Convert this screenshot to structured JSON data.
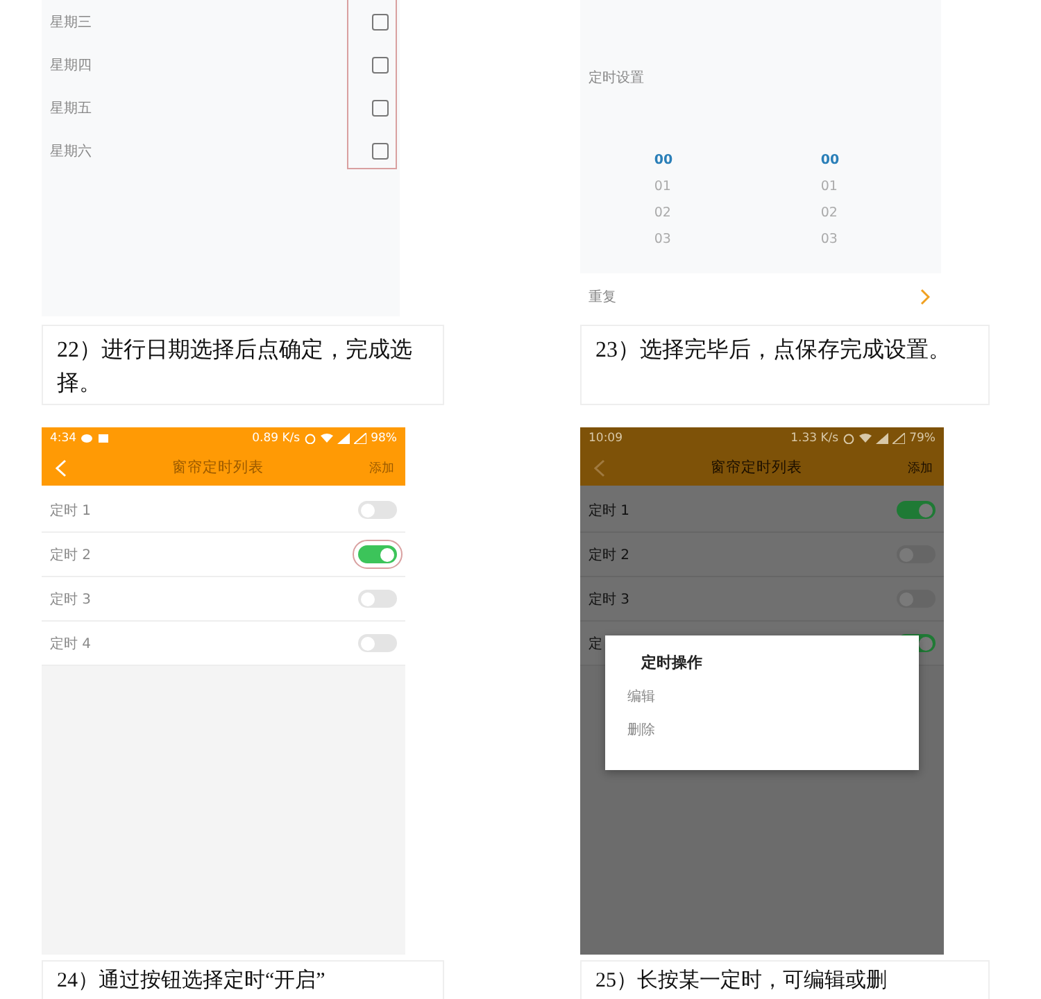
{
  "step22_screen": {
    "days": [
      {
        "label": "星期三",
        "checked": false
      },
      {
        "label": "星期四",
        "checked": false
      },
      {
        "label": "星期五",
        "checked": false
      },
      {
        "label": "星期六",
        "checked": false
      }
    ]
  },
  "step23_screen": {
    "section_title": "定时设置",
    "hour_column": [
      {
        "value": "00",
        "selected": true
      },
      {
        "value": "01",
        "selected": false
      },
      {
        "value": "02",
        "selected": false
      },
      {
        "value": "03",
        "selected": false
      }
    ],
    "minute_column": [
      {
        "value": "00",
        "selected": true
      },
      {
        "value": "01",
        "selected": false
      },
      {
        "value": "02",
        "selected": false
      },
      {
        "value": "03",
        "selected": false
      }
    ],
    "repeat_label": "重复"
  },
  "captions_top": [
    "22）进行日期选择后点确定，完成选择。",
    "23）选择完毕后，点保存完成设置。"
  ],
  "step24_screen": {
    "status_bar": {
      "time": "4:34",
      "speed": "0.89 K/s",
      "battery": "98%"
    },
    "title": "窗帘定时列表",
    "action": "添加",
    "timers": [
      {
        "label": "定时 1",
        "on": false
      },
      {
        "label": "定时 2",
        "on": true
      },
      {
        "label": "定时 3",
        "on": false
      },
      {
        "label": "定时 4",
        "on": false
      }
    ]
  },
  "step25_screen": {
    "status_bar": {
      "time": "10:09",
      "speed": "1.33 K/s",
      "battery": "79%"
    },
    "title": "窗帘定时列表",
    "action": "添加",
    "timers": [
      {
        "label": "定时 1",
        "on": true
      },
      {
        "label": "定时 2",
        "on": false
      },
      {
        "label": "定时 3",
        "on": false
      },
      {
        "label": "定",
        "on": true
      }
    ],
    "dialog": {
      "title": "定时操作",
      "options": [
        "编辑",
        "删除"
      ]
    }
  },
  "captions_bottom": [
    "24）通过按钮选择定时“开启”",
    "25）长按某一定时，可编辑或删"
  ]
}
